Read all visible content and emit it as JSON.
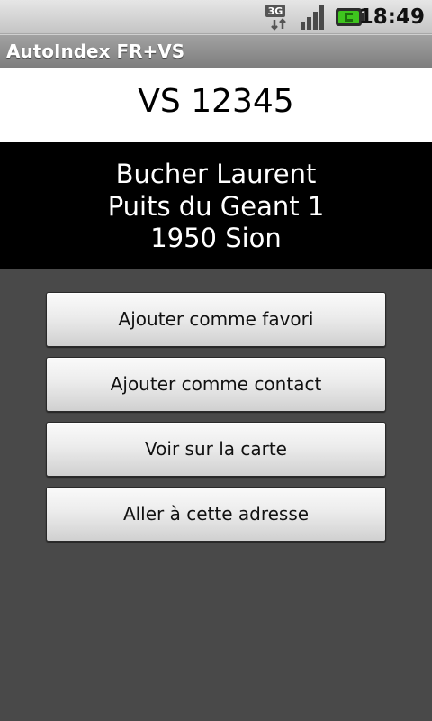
{
  "status_bar": {
    "network_label": "3G",
    "network_icon": "network-3g-icon",
    "signal_icon": "signal-strength-icon",
    "battery_icon": "battery-charging-icon",
    "time": "18:49"
  },
  "app": {
    "title": "AutoIndex FR+VS"
  },
  "plate": {
    "number": "VS 12345"
  },
  "owner": {
    "name": "Bucher Laurent",
    "street": "Puits du Geant 1",
    "city": "1950 Sion"
  },
  "actions": [
    {
      "label": "Ajouter comme favori"
    },
    {
      "label": "Ajouter comme contact"
    },
    {
      "label": "Voir sur la carte"
    },
    {
      "label": "Aller à cette adresse"
    }
  ],
  "colors": {
    "background": "#494949",
    "owner_panel": "#000000",
    "plate_panel": "#ffffff",
    "battery_accent": "#3ec41e"
  }
}
